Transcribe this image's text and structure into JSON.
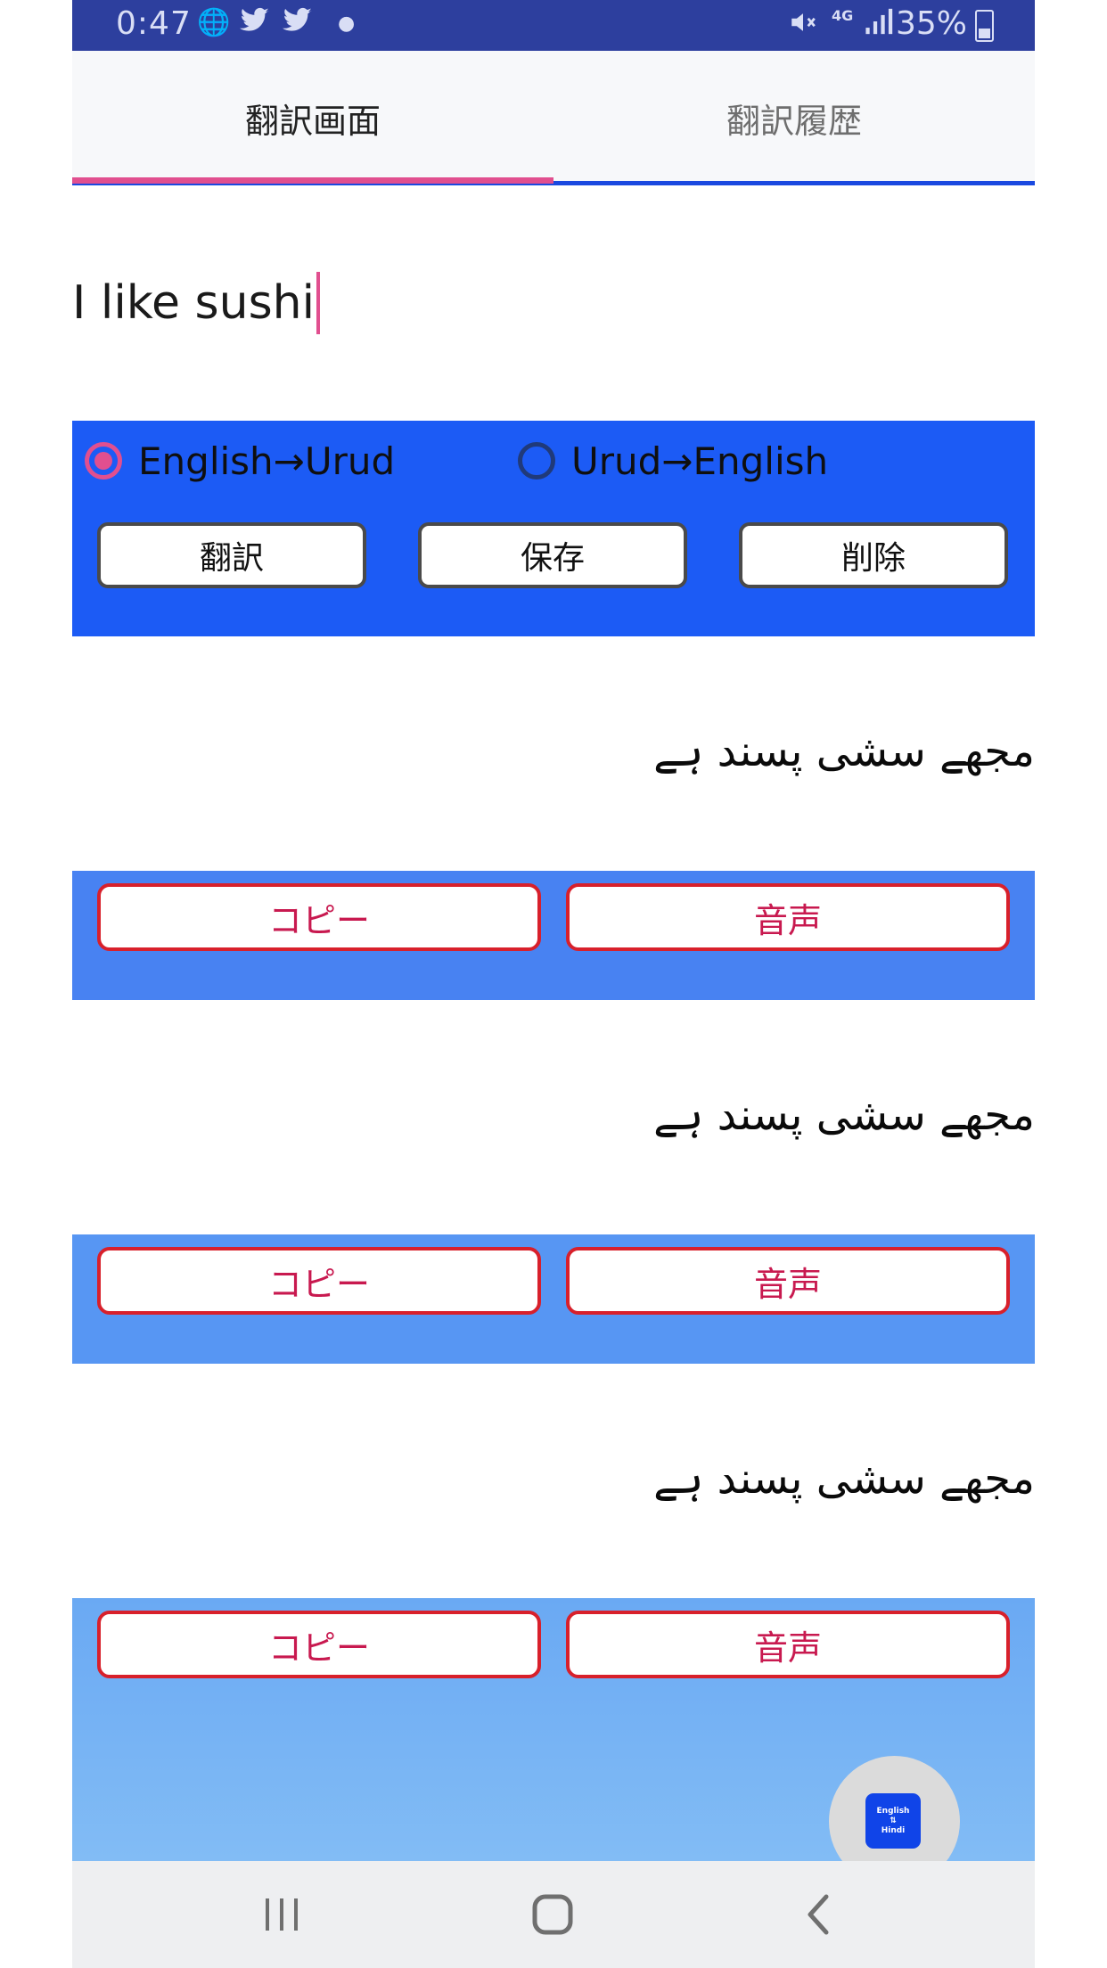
{
  "status_bar": {
    "time": "0:47",
    "battery": "35%",
    "network": "4G",
    "icons": [
      "globe-icon",
      "twitter-icon",
      "twitter-icon",
      "dot-icon",
      "mute-icon",
      "signal-icon",
      "battery-icon"
    ]
  },
  "tabs": [
    {
      "label": "翻訳画面",
      "active": true
    },
    {
      "label": "翻訳履歴",
      "active": false
    }
  ],
  "input": {
    "value": "I like sushi"
  },
  "direction": {
    "options": [
      {
        "label": "English→Urud",
        "selected": true
      },
      {
        "label": "Urud→English",
        "selected": false
      }
    ]
  },
  "actions": {
    "translate": "翻訳",
    "save": "保存",
    "delete": "削除"
  },
  "results": [
    {
      "text": "مجھے سشی پسند ہے",
      "copy_label": "コピー",
      "speak_label": "音声"
    },
    {
      "text": "مجھے سشی پسند ہے",
      "copy_label": "コピー",
      "speak_label": "音声"
    },
    {
      "text": "مجھے سشی پسند ہے",
      "copy_label": "コピー",
      "speak_label": "音声"
    }
  ],
  "fab": {
    "line1": "English",
    "line2": "⇅",
    "line3": "Hindi"
  },
  "colors": {
    "status_bar": "#2d3f9e",
    "accent_pink": "#e14f8f",
    "panel_blue": "#1c5bf5",
    "button_border_red": "#d8202b",
    "button_text_red": "#c8194f"
  }
}
